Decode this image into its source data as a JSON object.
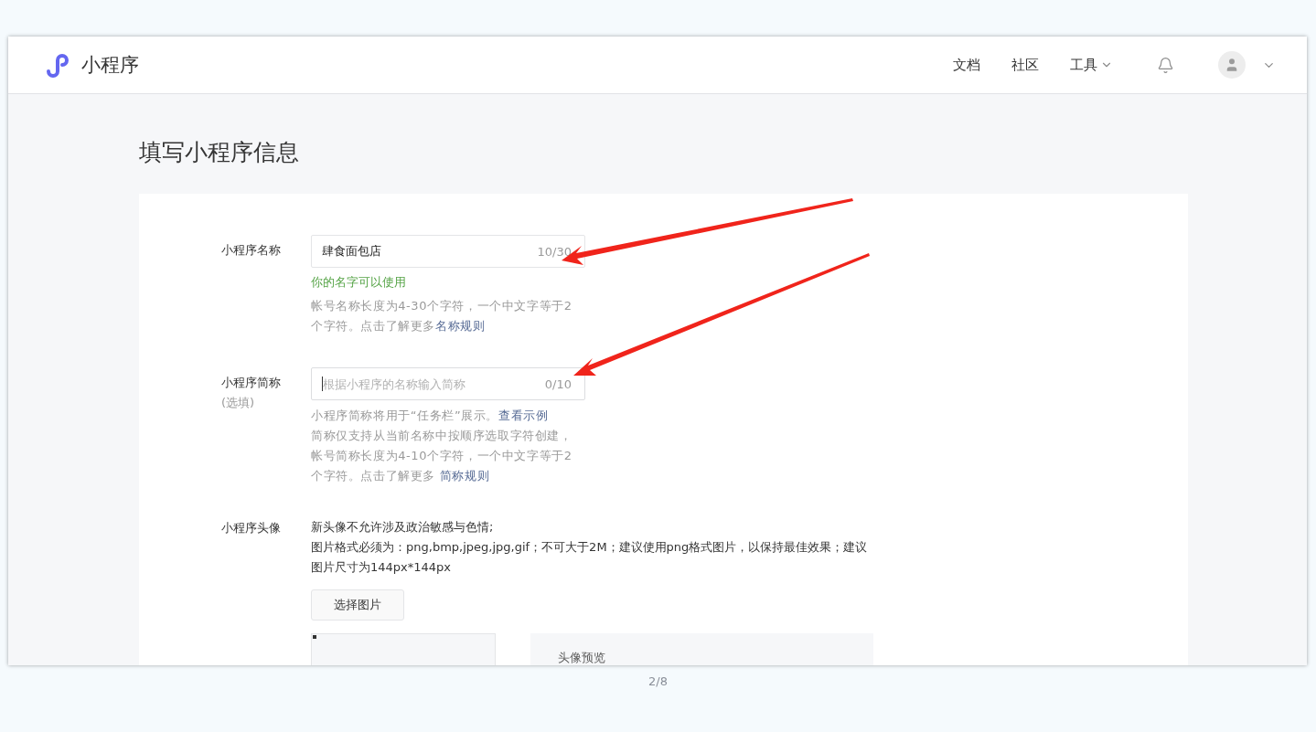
{
  "header": {
    "logo_text": "小程序",
    "nav": [
      {
        "label": "文档",
        "kind": "link"
      },
      {
        "label": "社区",
        "kind": "link"
      },
      {
        "label": "工具",
        "kind": "dropdown"
      }
    ]
  },
  "page_title": "填写小程序信息",
  "form": {
    "name": {
      "label": "小程序名称",
      "value": "肆食面包店",
      "counter": "10/30",
      "status": "你的名字可以使用",
      "help": [
        [
          {
            "kind": "text",
            "text": "帐号名称长度为4-30个字符，一个中文字等于2个字符。点击了解更多"
          },
          {
            "kind": "link",
            "text": "名称规则"
          }
        ]
      ]
    },
    "short_name": {
      "label": "小程序简称",
      "sublabel": "(选填)",
      "placeholder": "根据小程序的名称输入简称",
      "counter": "0/10",
      "focused": true,
      "help": [
        [
          {
            "kind": "text",
            "text": "小程序简称将用于“任务栏”展示。"
          },
          {
            "kind": "link",
            "text": "查看示例"
          }
        ],
        [
          {
            "kind": "text",
            "text": "简称仅支持从当前名称中按顺序选取字符创建，帐号简称长度为4-10个字符，一个中文字等于2个字符。点击了解更多 "
          },
          {
            "kind": "link",
            "text": "简称规则"
          }
        ]
      ]
    },
    "avatar": {
      "label": "小程序头像",
      "notes": [
        "新头像不允许涉及政治敏感与色情;",
        "图片格式必须为：png,bmp,jpeg,jpg,gif；不可大于2M；建议使用png格式图片，以保持最佳效果；建议图片尺寸为144px*144px"
      ],
      "button": "选择图片",
      "preview_title": "头像预览"
    }
  },
  "pager": "2/8"
}
